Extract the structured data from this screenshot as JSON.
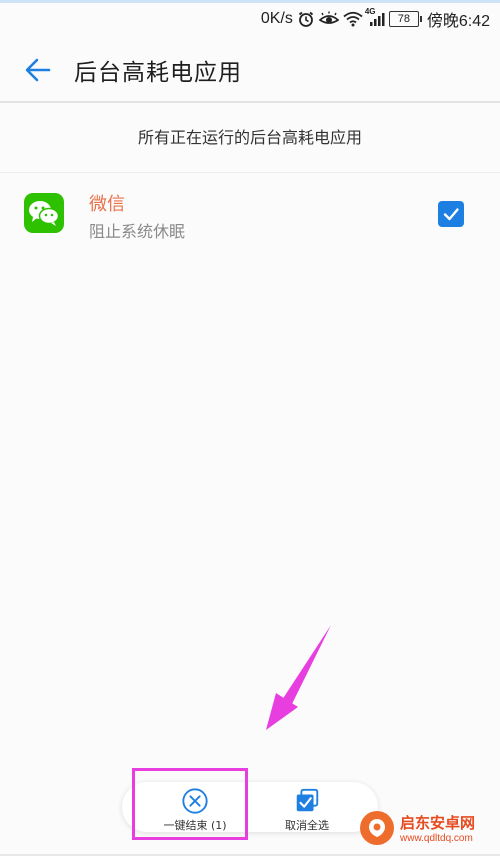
{
  "status_bar": {
    "net_speed": "0K/s",
    "signal_label": "4G",
    "battery": "78",
    "time": "傍晚6:42"
  },
  "header": {
    "title": "后台高耗电应用"
  },
  "section": {
    "subtitle": "所有正在运行的后台高耗电应用"
  },
  "apps": [
    {
      "name": "微信",
      "status": "阻止系统休眠",
      "checked": true,
      "icon": "wechat-icon"
    }
  ],
  "bottom_bar": {
    "end_label": "一键结束 (1)",
    "deselect_label": "取消全选"
  },
  "watermark": {
    "name": "启东安卓网",
    "url": "www.qdltdq.com"
  },
  "colors": {
    "accent": "#1e7fe3",
    "app_name": "#e8714a",
    "annotation": "#e83ee0",
    "wechat": "#2dc100"
  }
}
